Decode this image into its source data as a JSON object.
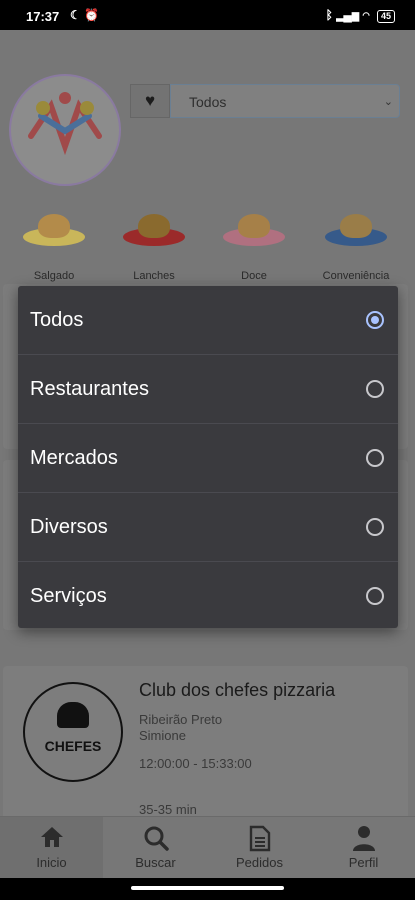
{
  "status_bar": {
    "time": "17:37",
    "icons": [
      "moon-icon",
      "alarm-icon"
    ],
    "right_icons": [
      "bluetooth-icon",
      "signal-icon",
      "wifi-icon"
    ],
    "battery": "45"
  },
  "filter": {
    "selected": "Todos"
  },
  "categories": [
    {
      "label": "Salgado",
      "icon": "salgado-icon",
      "plate_color": "#c9b65a",
      "food_color": "#b38b4a"
    },
    {
      "label": "Lanches",
      "icon": "lanches-icon",
      "plate_color": "#9b2a2a",
      "food_color": "#8a6a2e"
    },
    {
      "label": "Doce",
      "icon": "doce-icon",
      "plate_color": "#b07080",
      "food_color": "#a68048"
    },
    {
      "label": "Conveniência",
      "icon": "conveniencia-icon",
      "plate_color": "#365a8a",
      "food_color": "#9a7d48"
    }
  ],
  "dialog": {
    "options": [
      {
        "label": "Todos",
        "selected": true
      },
      {
        "label": "Restaurantes",
        "selected": false
      },
      {
        "label": "Mercados",
        "selected": false
      },
      {
        "label": "Diversos",
        "selected": false
      },
      {
        "label": "Serviços",
        "selected": false
      }
    ]
  },
  "restaurant": {
    "logo_text": "CHEFES",
    "name": "Club dos chefes pizzaria",
    "city": "Ribeirão Preto",
    "district": "Simione",
    "hours": "12:00:00 - 15:33:00",
    "delivery_time": "35-35 min"
  },
  "bottom_nav": [
    {
      "label": "Inicio",
      "icon": "home-icon",
      "active": true
    },
    {
      "label": "Buscar",
      "icon": "search-icon",
      "active": false
    },
    {
      "label": "Pedidos",
      "icon": "document-icon",
      "active": false
    },
    {
      "label": "Perfil",
      "icon": "person-icon",
      "active": false
    }
  ],
  "colors": {
    "accent": "#a9c3ff",
    "dialog_bg": "#3a3a3e",
    "scrim": "#777777"
  }
}
